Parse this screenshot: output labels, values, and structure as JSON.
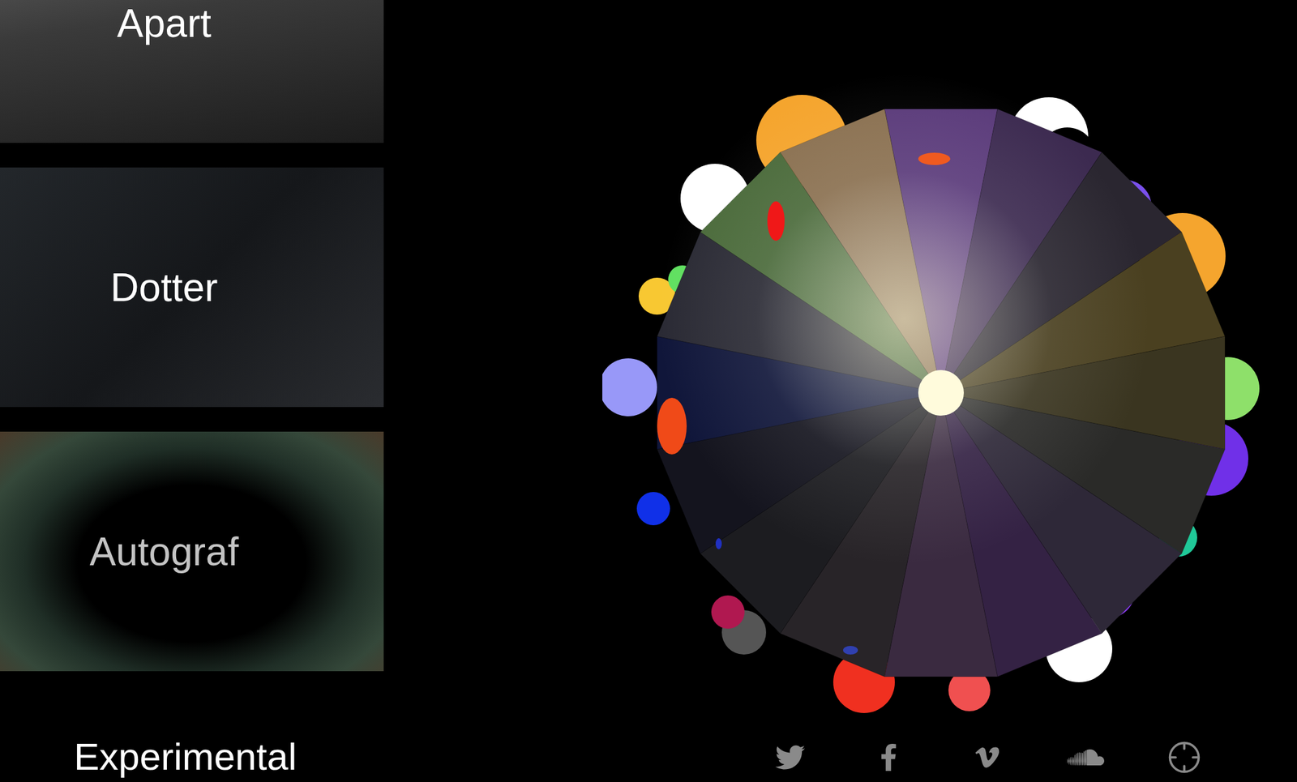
{
  "projects": [
    {
      "title": "Apart",
      "dimmed": false
    },
    {
      "title": "Dotter",
      "dimmed": false
    },
    {
      "title": "Autograf",
      "dimmed": true
    }
  ],
  "section_heading": "Experimental"
}
